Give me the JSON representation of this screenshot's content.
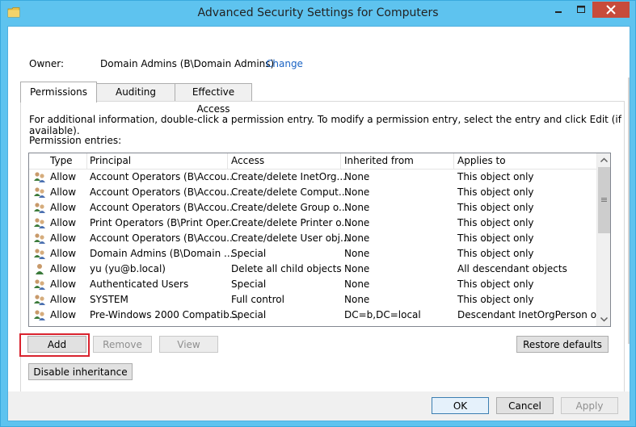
{
  "window": {
    "title": "Advanced Security Settings for Computers",
    "icon": "folder-icon",
    "accent": "#5ec3ef",
    "close_color": "#c74b3b"
  },
  "owner": {
    "label": "Owner:",
    "value": "Domain Admins (B\\Domain Admins)",
    "change_link": "Change",
    "link_color": "#1a63c4"
  },
  "tabs": [
    {
      "label": "Permissions",
      "active": true
    },
    {
      "label": "Auditing",
      "active": false
    },
    {
      "label": "Effective Access",
      "active": false
    }
  ],
  "permissions": {
    "info_text": "For additional information, double-click a permission entry. To modify a permission entry, select the entry and click Edit (if available).",
    "entries_label": "Permission entries:",
    "columns": [
      "Type",
      "Principal",
      "Access",
      "Inherited from",
      "Applies to"
    ],
    "rows": [
      {
        "icon": "group-icon",
        "type": "Allow",
        "principal": "Account Operators (B\\Accou...",
        "access": "Create/delete InetOrg...",
        "inherited": "None",
        "applies": "This object only"
      },
      {
        "icon": "group-icon",
        "type": "Allow",
        "principal": "Account Operators (B\\Accou...",
        "access": "Create/delete Comput...",
        "inherited": "None",
        "applies": "This object only"
      },
      {
        "icon": "group-icon",
        "type": "Allow",
        "principal": "Account Operators (B\\Accou...",
        "access": "Create/delete Group o...",
        "inherited": "None",
        "applies": "This object only"
      },
      {
        "icon": "group-icon",
        "type": "Allow",
        "principal": "Print Operators (B\\Print Oper...",
        "access": "Create/delete Printer o...",
        "inherited": "None",
        "applies": "This object only"
      },
      {
        "icon": "group-icon",
        "type": "Allow",
        "principal": "Account Operators (B\\Accou...",
        "access": "Create/delete User obj...",
        "inherited": "None",
        "applies": "This object only"
      },
      {
        "icon": "group-icon",
        "type": "Allow",
        "principal": "Domain Admins (B\\Domain ...",
        "access": "Special",
        "inherited": "None",
        "applies": "This object only"
      },
      {
        "icon": "user-icon",
        "type": "Allow",
        "principal": "yu (yu@b.local)",
        "access": "Delete all child objects",
        "inherited": "None",
        "applies": "All descendant objects"
      },
      {
        "icon": "group-icon",
        "type": "Allow",
        "principal": "Authenticated Users",
        "access": "Special",
        "inherited": "None",
        "applies": "This object only"
      },
      {
        "icon": "group-icon",
        "type": "Allow",
        "principal": "SYSTEM",
        "access": "Full control",
        "inherited": "None",
        "applies": "This object only"
      },
      {
        "icon": "group-icon",
        "type": "Allow",
        "principal": "Pre-Windows 2000 Compatib...",
        "access": "Special",
        "inherited": "DC=b,DC=local",
        "applies": "Descendant InetOrgPerson o..."
      }
    ]
  },
  "buttons": {
    "add": "Add",
    "remove": "Remove",
    "view": "View",
    "restore": "Restore defaults",
    "disable_inheritance": "Disable inheritance",
    "ok": "OK",
    "cancel": "Cancel",
    "apply": "Apply"
  },
  "highlight_color": "#d9232e"
}
